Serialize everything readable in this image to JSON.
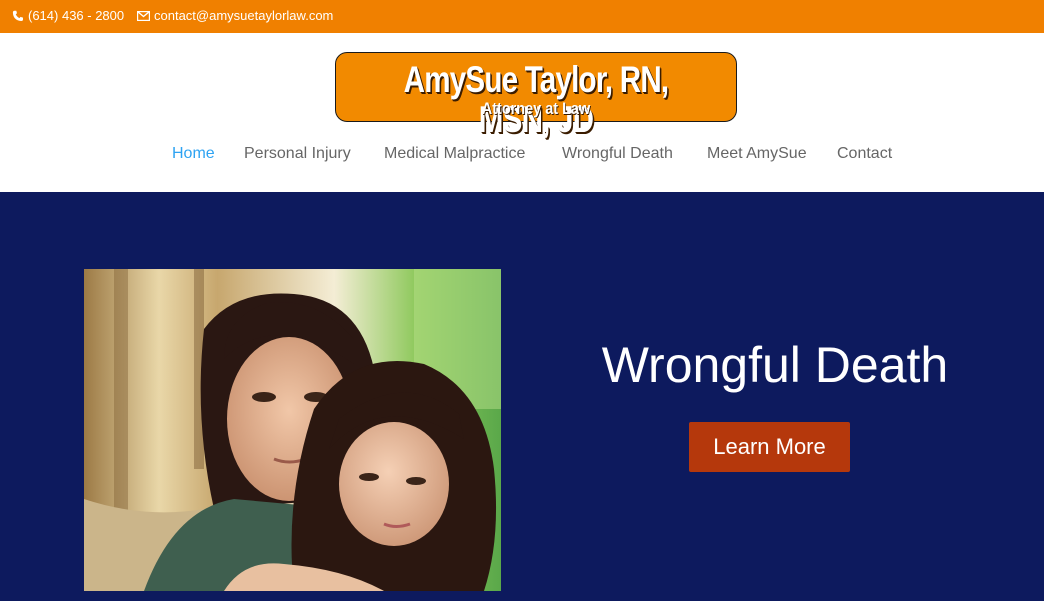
{
  "topbar": {
    "phone": "(614) 436 - 2800",
    "email": "contact@amysuetaylorlaw.com",
    "phone_icon": "phone-icon",
    "email_icon": "envelope-icon"
  },
  "logo": {
    "line1": "AmySue Taylor, RN, MSN, JD",
    "line2": "Attorney at Law"
  },
  "nav": {
    "items": [
      {
        "label": "Home"
      },
      {
        "label": "Personal Injury"
      },
      {
        "label": "Medical Malpractice"
      },
      {
        "label": "Wrongful Death"
      },
      {
        "label": "Meet AmySue"
      },
      {
        "label": "Contact"
      }
    ]
  },
  "hero": {
    "title": "Wrongful Death",
    "button": "Learn More"
  },
  "colors": {
    "topbar": "#f08000",
    "active_nav": "#2ea3f2",
    "hero_bg": "#0d1a5e",
    "button": "#b5380c"
  }
}
